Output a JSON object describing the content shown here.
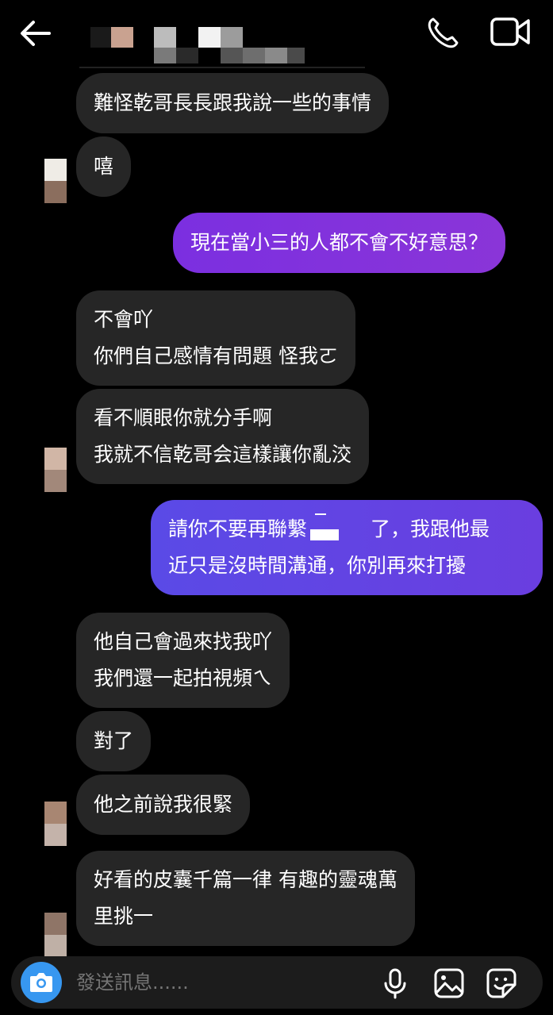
{
  "header": {
    "back_icon": "arrow-left-icon",
    "call_icon": "phone-icon",
    "video_icon": "video-camera-icon"
  },
  "messages": [
    {
      "side": "in",
      "lines": [
        "難怪乾哥長長跟我說一些的事情"
      ]
    },
    {
      "side": "in",
      "lines": [
        "嘻"
      ]
    },
    {
      "side": "out",
      "lines": [
        "現在當小三的人都不會不好意思？"
      ]
    },
    {
      "side": "in",
      "lines": [
        "不會吖",
        "你們自己感情有問題 怪我ㄛ"
      ]
    },
    {
      "side": "in",
      "lines": [
        "看不順眼你就分手啊",
        "我就不信乾哥会這樣讓你亂洨"
      ]
    },
    {
      "side": "out",
      "lines": [
        "請你不要再聯繫",
        "了，我跟他最",
        "近只是沒時間溝通，你別再來打擾"
      ]
    },
    {
      "side": "in",
      "lines": [
        "他自己會過來找我吖",
        "我們還一起拍視頻ㄟ"
      ]
    },
    {
      "side": "in",
      "lines": [
        "對了"
      ]
    },
    {
      "side": "in",
      "lines": [
        "他之前說我很緊"
      ]
    },
    {
      "side": "in",
      "lines": [
        "好看的皮囊千篇一律 有趣的靈魂萬",
        "里挑一"
      ]
    }
  ],
  "composer": {
    "placeholder": "發送訊息......",
    "camera_icon": "camera-icon",
    "mic_icon": "microphone-icon",
    "gallery_icon": "image-gallery-icon",
    "sticker_icon": "sticker-icon"
  },
  "colors": {
    "incoming_bubble": "#262626",
    "outgoing_bubble_1": "#7b2fe0",
    "outgoing_bubble_2": "#5a4ae6",
    "camera_button": "#3797f0",
    "background": "#000000"
  }
}
